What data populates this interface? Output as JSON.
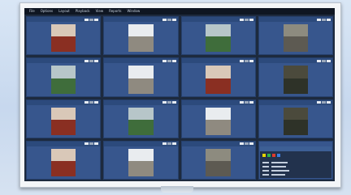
{
  "menubar": {
    "items": [
      "File",
      "Options",
      "Layout",
      "Playback",
      "View",
      "Reports",
      "Window"
    ]
  },
  "tiles": [
    {
      "name": "",
      "scene": "v-red"
    },
    {
      "name": "",
      "scene": "v-white"
    },
    {
      "name": "",
      "scene": "v-green"
    },
    {
      "name": "",
      "scene": "v-gray"
    },
    {
      "name": "",
      "scene": "v-green"
    },
    {
      "name": "",
      "scene": "v-white"
    },
    {
      "name": "",
      "scene": "v-red"
    },
    {
      "name": "",
      "scene": "v-dark"
    },
    {
      "name": "",
      "scene": "v-red"
    },
    {
      "name": "",
      "scene": "v-green"
    },
    {
      "name": "",
      "scene": "v-white"
    },
    {
      "name": "",
      "scene": "v-dark"
    },
    {
      "name": "",
      "scene": "v-red"
    },
    {
      "name": "",
      "scene": "v-white"
    },
    {
      "name": "",
      "scene": "v-gray"
    }
  ],
  "panel": {
    "title": "",
    "button_label": "",
    "dot_colors": [
      "#e6d400",
      "#2fb34a",
      "#e03b2b",
      "#3a7de0"
    ]
  },
  "colors": {
    "tile_bg": "#37568d",
    "screen_bg": "#1d2a3e"
  }
}
